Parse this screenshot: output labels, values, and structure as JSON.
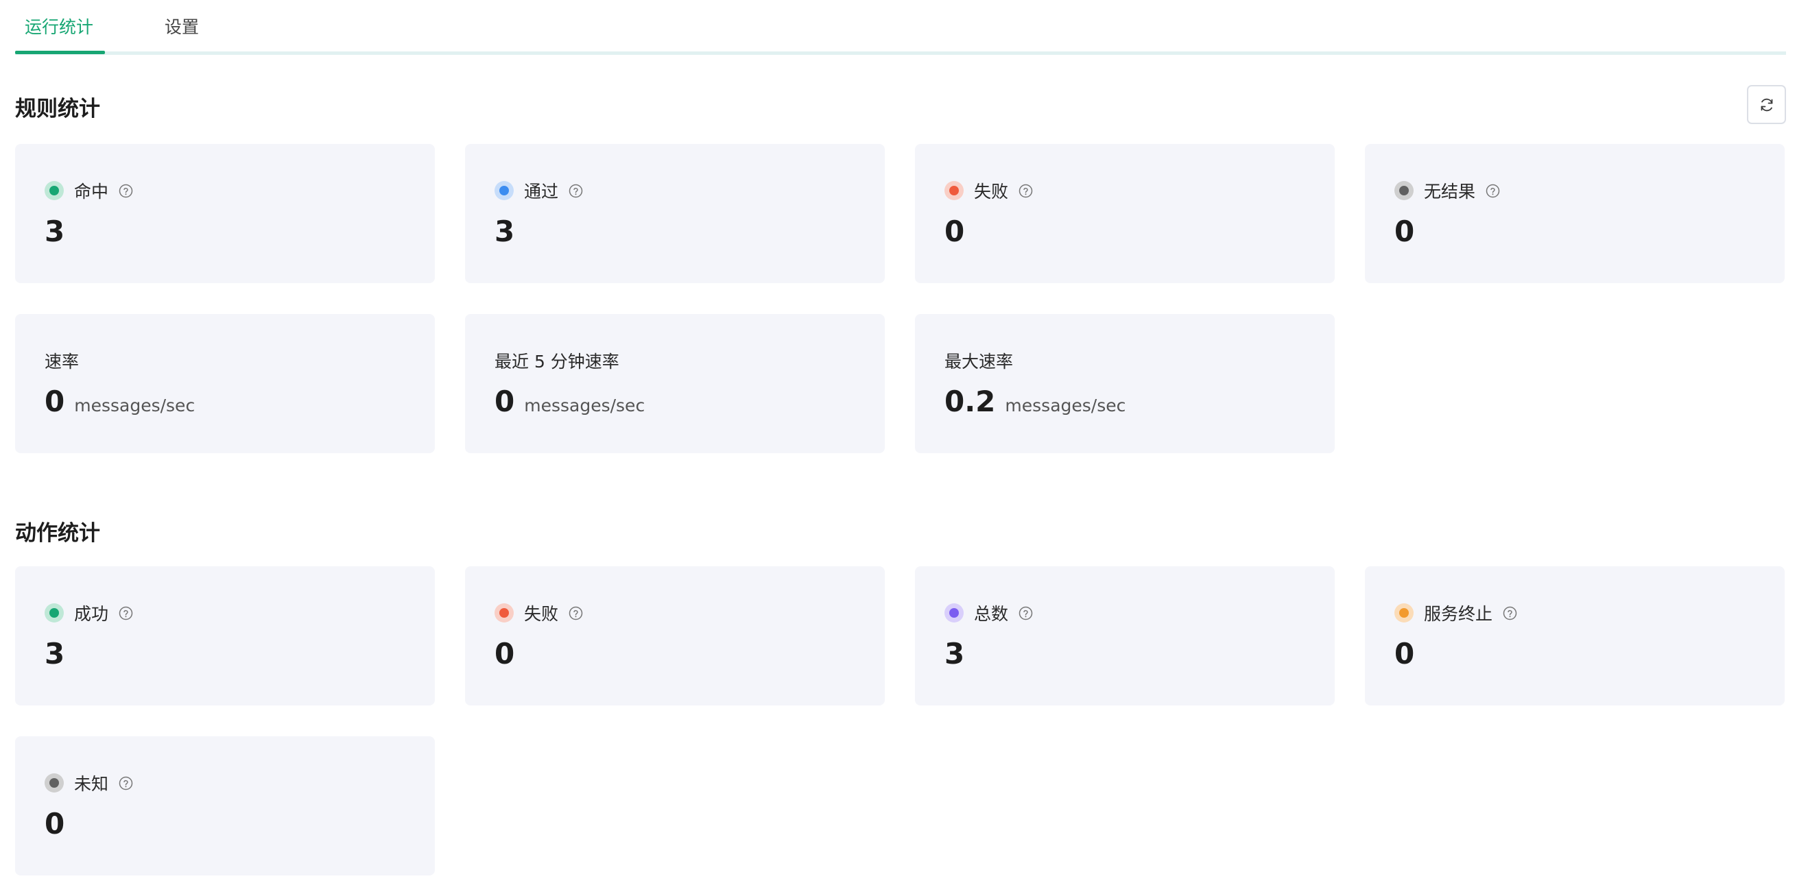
{
  "tabs": [
    {
      "label": "运行统计",
      "active": true
    },
    {
      "label": "设置",
      "active": false
    }
  ],
  "rule_stats": {
    "title": "规则统计",
    "refresh_icon": "refresh-icon",
    "cards": [
      {
        "label": "命中",
        "value": "3",
        "dot_color": "#17a673",
        "dot_bg": "#bfe8d7",
        "help_icon": "question-circle-icon"
      },
      {
        "label": "通过",
        "value": "3",
        "dot_color": "#3b8cf0",
        "dot_bg": "#c7ddfa",
        "help_icon": "question-circle-icon"
      },
      {
        "label": "失败",
        "value": "0",
        "dot_color": "#ef5a3c",
        "dot_bg": "#f9cfc6",
        "help_icon": "question-circle-icon"
      },
      {
        "label": "无结果",
        "value": "0",
        "dot_color": "#606060",
        "dot_bg": "#cfcfcf",
        "help_icon": "question-circle-icon"
      }
    ],
    "rates": [
      {
        "label": "速率",
        "value": "0",
        "unit": "messages/sec"
      },
      {
        "label": "最近 5 分钟速率",
        "value": "0",
        "unit": "messages/sec"
      },
      {
        "label": "最大速率",
        "value": "0.2",
        "unit": "messages/sec"
      }
    ]
  },
  "action_stats": {
    "title": "动作统计",
    "cards": [
      {
        "label": "成功",
        "value": "3",
        "dot_color": "#17a673",
        "dot_bg": "#bfe8d7",
        "help_icon": "question-circle-icon"
      },
      {
        "label": "失败",
        "value": "0",
        "dot_color": "#ef5a3c",
        "dot_bg": "#f9cfc6",
        "help_icon": "question-circle-icon"
      },
      {
        "label": "总数",
        "value": "3",
        "dot_color": "#7b5cf0",
        "dot_bg": "#d9cffb",
        "help_icon": "question-circle-icon"
      },
      {
        "label": "服务终止",
        "value": "0",
        "dot_color": "#f29a2e",
        "dot_bg": "#fbdcb8",
        "help_icon": "question-circle-icon"
      },
      {
        "label": "未知",
        "value": "0",
        "dot_color": "#606060",
        "dot_bg": "#cfcfcf",
        "help_icon": "question-circle-icon"
      }
    ]
  }
}
